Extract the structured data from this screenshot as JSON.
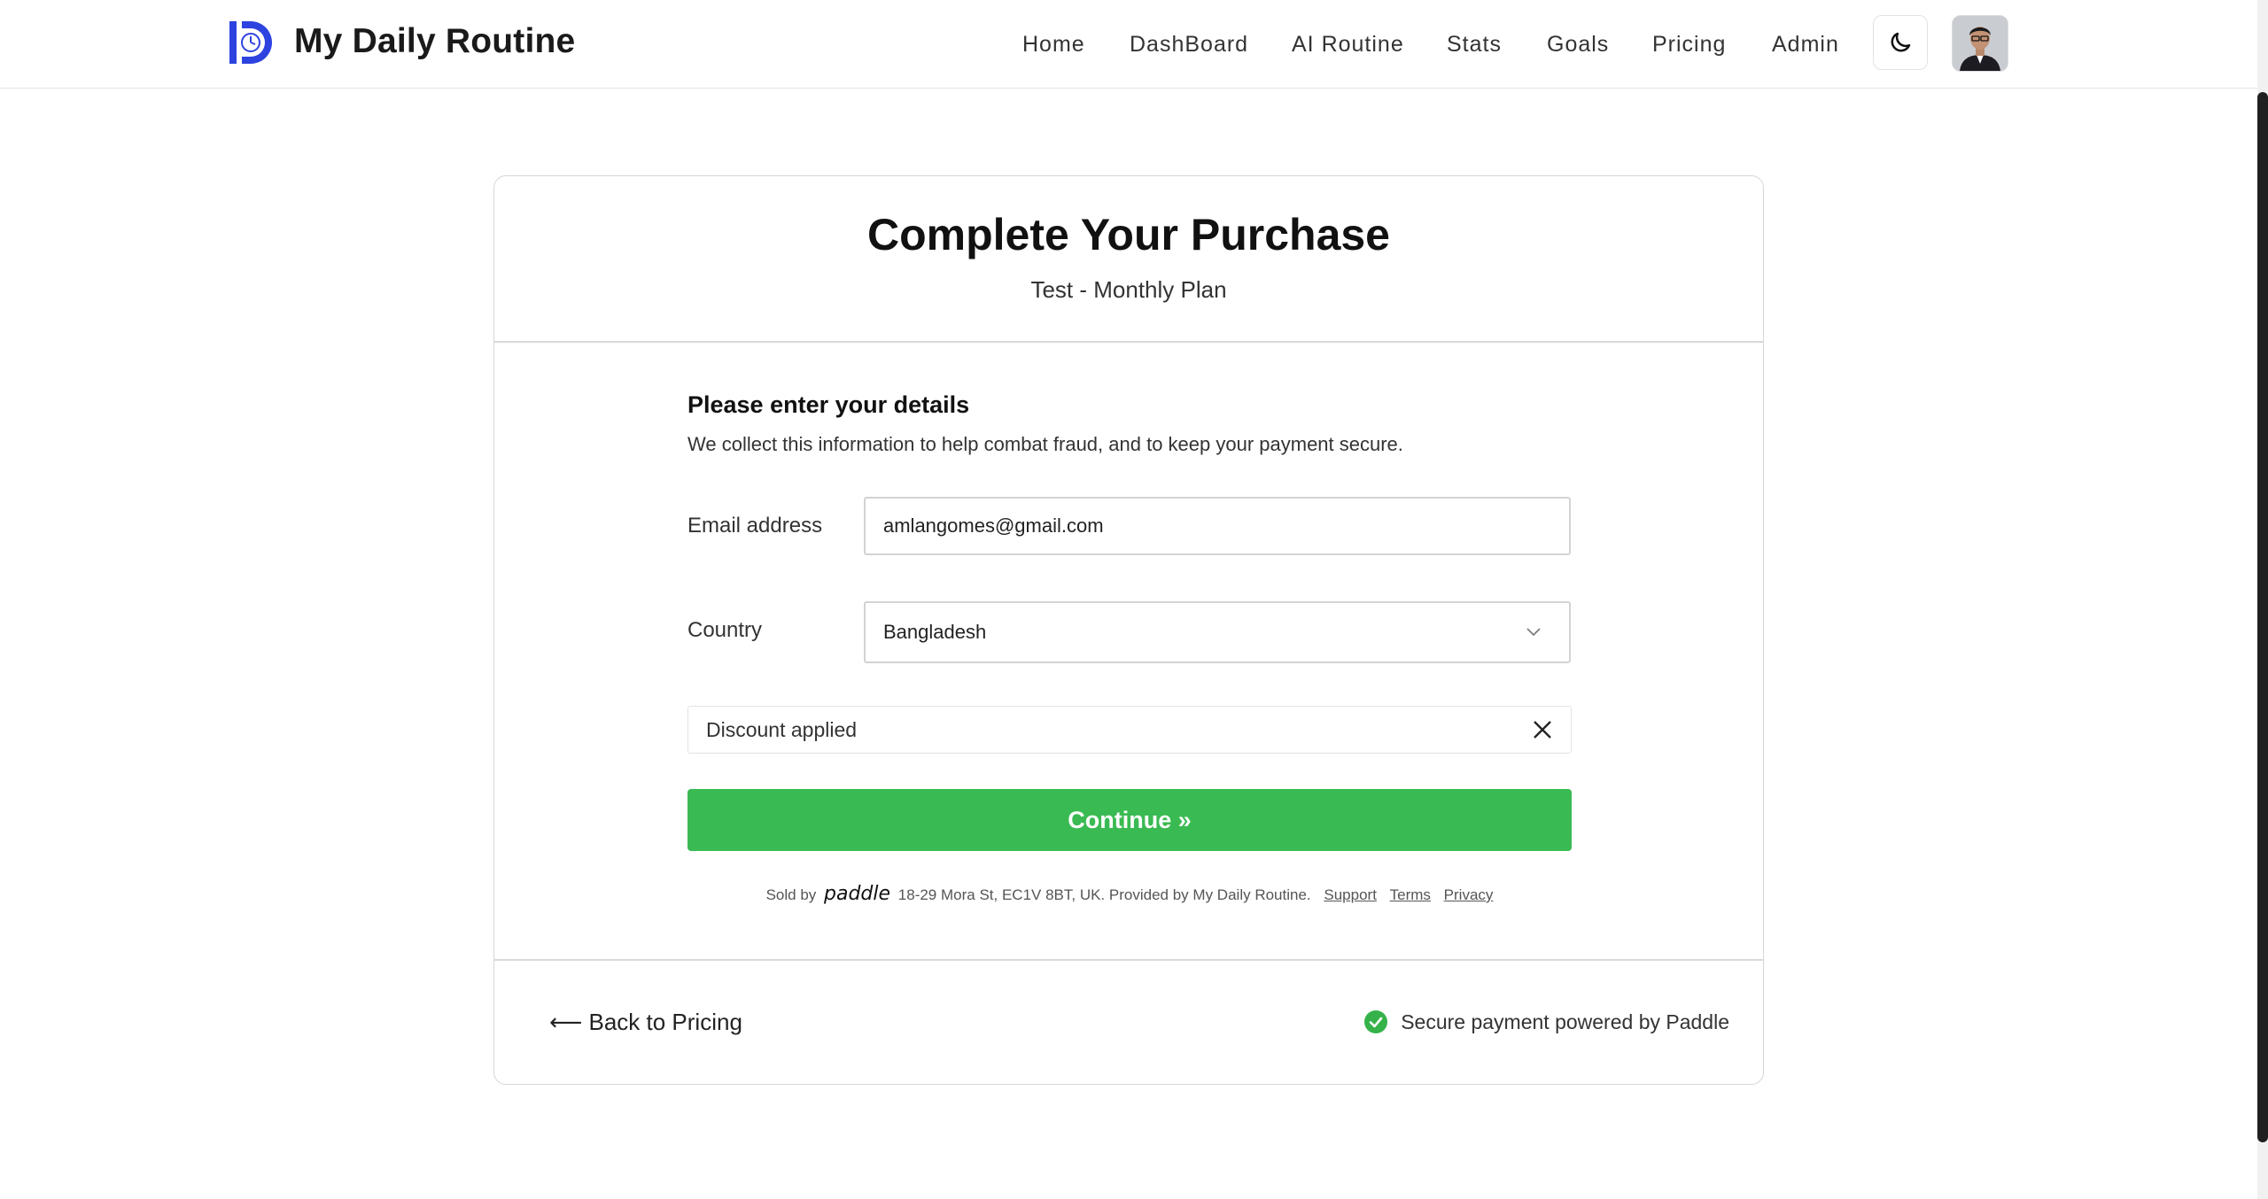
{
  "header": {
    "brand": "My Daily Routine",
    "nav": [
      {
        "label": "Home"
      },
      {
        "label": "DashBoard"
      },
      {
        "label": "AI Routine"
      },
      {
        "label": "Stats"
      },
      {
        "label": "Goals"
      },
      {
        "label": "Pricing"
      },
      {
        "label": "Admin"
      }
    ],
    "theme_toggle_icon": "moon-icon"
  },
  "checkout": {
    "title": "Complete Your Purchase",
    "plan": "Test - Monthly Plan",
    "form_heading": "Please enter your details",
    "form_description": "We collect this information to help combat fraud, and to keep your payment secure.",
    "email_label": "Email address",
    "email_value": "amlangomes@gmail.com",
    "country_label": "Country",
    "country_value": "Bangladesh",
    "discount_text": "Discount applied",
    "continue_label": "Continue »",
    "footer": {
      "sold_by": "Sold by",
      "paddle_logo": "paddle",
      "address": "18-29 Mora St, EC1V 8BT, UK.",
      "provided_by": "Provided by",
      "provider": "My Daily Routine.",
      "support": "Support",
      "terms": "Terms",
      "privacy": "Privacy"
    },
    "back_label": "⟵ Back to Pricing",
    "secure_text": "Secure payment powered by Paddle"
  },
  "colors": {
    "accent_blue": "#2d43e0",
    "continue_green": "#3aba52",
    "check_green": "#35b24a"
  }
}
